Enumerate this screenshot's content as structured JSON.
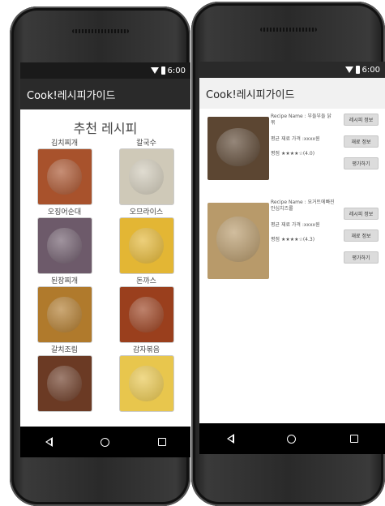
{
  "status": {
    "time": "6:00"
  },
  "app": {
    "title": "Cook!레시피가이드"
  },
  "screen1": {
    "heading": "추천 레시피",
    "recipes": [
      {
        "label": "김치찌개",
        "color": "#a8522c"
      },
      {
        "label": "칼국수",
        "color": "#cfc9b8"
      },
      {
        "label": "오징어순대",
        "color": "#6d5a6a"
      },
      {
        "label": "오므라이스",
        "color": "#e3b634"
      },
      {
        "label": "된장찌개",
        "color": "#b07a2c"
      },
      {
        "label": "돈까스",
        "color": "#9a3f1d"
      },
      {
        "label": "갈치조림",
        "color": "#6b3a24"
      },
      {
        "label": "감자볶음",
        "color": "#e8c64d"
      }
    ]
  },
  "screen2": {
    "items": [
      {
        "name": "Recipe Name : 부들부들 닭볶",
        "price": "평균 재료 가격 :xxxx원",
        "rating": "평점 ★★★★☆(4.0)",
        "color": "#5c4632"
      },
      {
        "name": "Recipe Name : 요거트에빠진 안심치즈롤",
        "price": "평균 재료 가격 :xxxx원",
        "rating": "평점 ★★★★☆(4.3)",
        "color": "#b89a6a"
      }
    ],
    "buttons": {
      "info": "레시피 정보",
      "ingredients": "재료 정보",
      "rate": "평가하기"
    }
  }
}
